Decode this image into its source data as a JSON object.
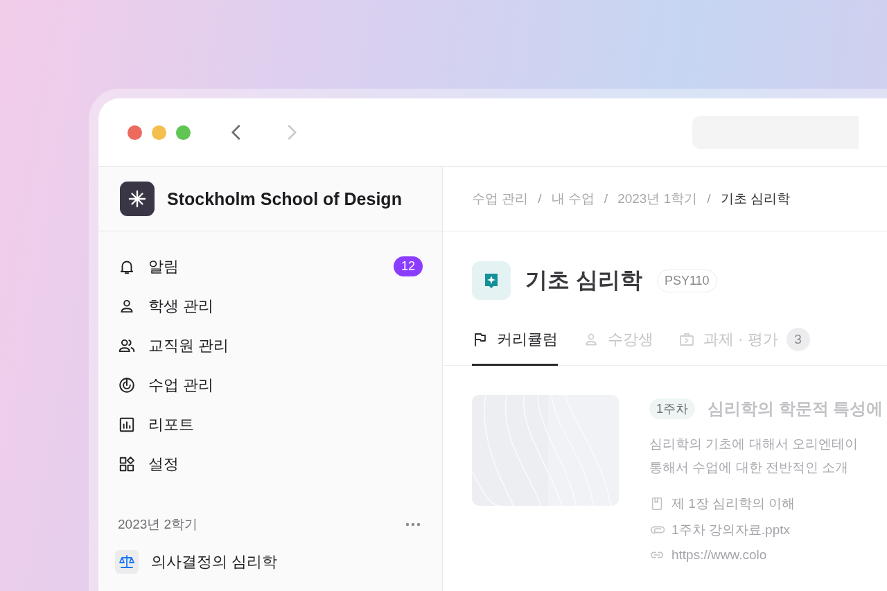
{
  "navigation": {
    "back_disabled": false,
    "forward_disabled": true
  },
  "sidebar": {
    "brand": "Stockholm School of Design",
    "items": [
      {
        "kind": "bell",
        "label": "알림",
        "badge": "12"
      },
      {
        "kind": "person",
        "label": "학생 관리"
      },
      {
        "kind": "people",
        "label": "교직원 관리"
      },
      {
        "kind": "target",
        "label": "수업 관리"
      },
      {
        "kind": "chart",
        "label": "리포트"
      },
      {
        "kind": "shapes",
        "label": "설정"
      }
    ],
    "section": {
      "title": "2023년 2학기",
      "courses": [
        {
          "kind": "scale",
          "label": "의사결정의 심리학"
        }
      ]
    }
  },
  "breadcrumb_separator": "/",
  "breadcrumb": [
    {
      "label": "수업 관리",
      "current": false
    },
    {
      "label": "내 수업",
      "current": false
    },
    {
      "label": "2023년 1학기",
      "current": false
    },
    {
      "label": "기초 심리학",
      "current": true
    }
  ],
  "course": {
    "title": "기초 심리학",
    "code": "PSY110"
  },
  "tabs": [
    {
      "kind": "flag",
      "label": "커리큘럼",
      "selected": true
    },
    {
      "kind": "person",
      "label": "수강생",
      "selected": false
    },
    {
      "kind": "case",
      "label": "과제 · 평가",
      "selected": false,
      "count": "3"
    }
  ],
  "lessons": [
    {
      "kind": "picture",
      "week": "1주차",
      "title": "심리학의 학문적 특성에",
      "description_lines": [
        "심리학의 기초에 대해서 오리엔테이",
        "통해서 수업에 대한 전반적인 소개"
      ],
      "attachments": [
        {
          "kind": "book",
          "label": "제 1장 심리학의 이해"
        },
        {
          "kind": "clip",
          "label": "1주차 강의자료.pptx"
        },
        {
          "kind": "link",
          "label": "https://www.colo"
        }
      ]
    }
  ]
}
